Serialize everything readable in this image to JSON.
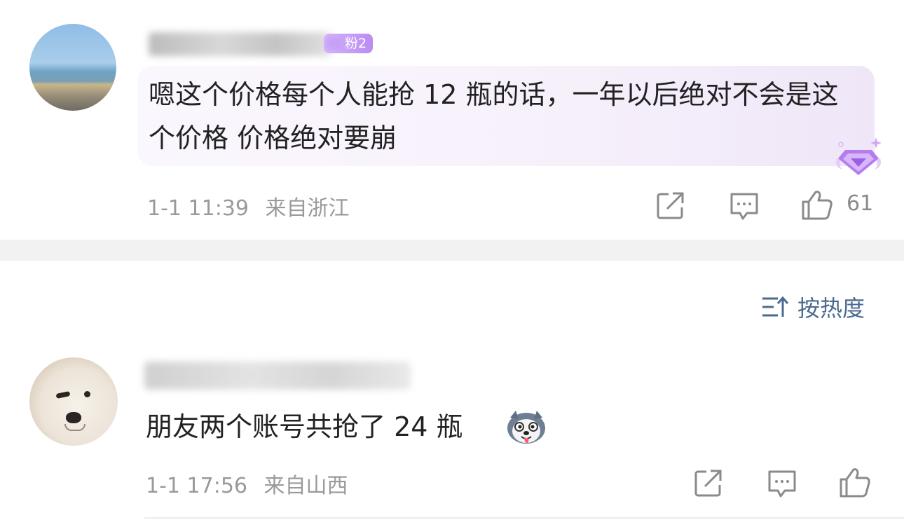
{
  "comments": [
    {
      "badge": "粉2",
      "text": "嗯这个价格每个人能抢 12 瓶的话，一年以后绝对不会是这个价格 价格绝对要崩",
      "time": "1-1 11:39",
      "location": "来自浙江",
      "likes": "61"
    },
    {
      "text": "朋友两个账号共抢了 24 瓶",
      "time": "1-1 17:56",
      "location": "来自山西",
      "likes": ""
    }
  ],
  "sort": {
    "label": "按热度"
  },
  "icons": {
    "share": "share-icon",
    "reply": "comment-icon",
    "like": "thumbs-up-icon",
    "sort": "sort-icon",
    "gem": "diamond-badge-icon",
    "emoji": "husky-emoji-icon"
  },
  "colors": {
    "accent": "#4d6a8e",
    "meta": "#9a9a9a",
    "badge": "#c79bf7",
    "separator": "#f2f2f2"
  }
}
